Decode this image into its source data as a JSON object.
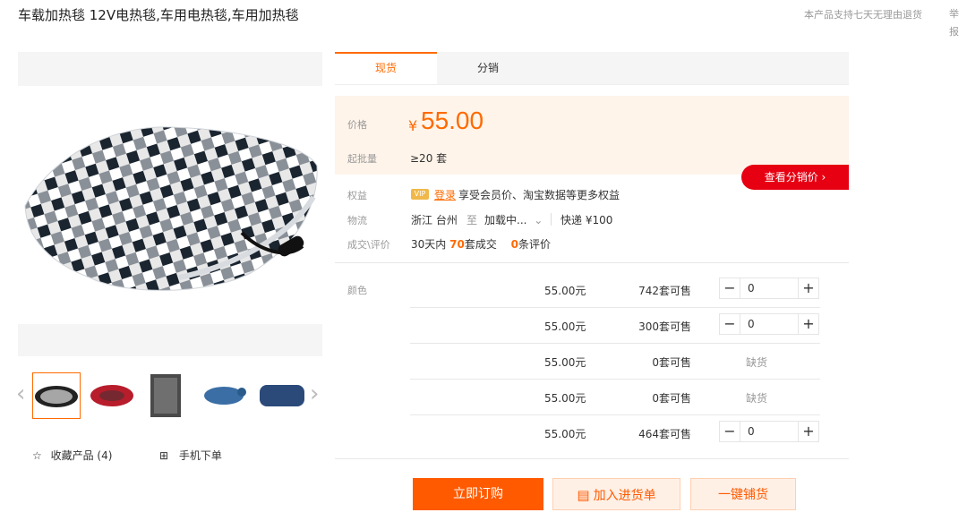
{
  "product": {
    "title": "车载加热毯 12V电热毯,车用电热毯,车用加热毯"
  },
  "header": {
    "return_note": "本产品支持七天无理由退货",
    "report": "举报"
  },
  "gallery": {
    "favorite": "收藏产品 (4)",
    "mobile_order": "手机下单"
  },
  "tabs": [
    "现货",
    "分销"
  ],
  "price": {
    "label": "价格",
    "currency": "¥",
    "value": "55.00",
    "min_label": "起批量",
    "min_value": "≥20 套",
    "distribution_button": "查看分销价 ›"
  },
  "benefits": {
    "label": "权益",
    "badge": "VIP",
    "login": "登录",
    "text": "享受会员价、淘宝数据等更多权益"
  },
  "logistics": {
    "label": "物流",
    "origin": "浙江 台州",
    "to": "至",
    "dest": "加载中...",
    "shipping": "快递 ¥100"
  },
  "deals": {
    "label": "成交\\评价",
    "prefix": "30天内",
    "count": "70",
    "count_suffix": "套成交",
    "reviews": "0",
    "reviews_suffix": "条评价"
  },
  "sku": {
    "color_label": "颜色",
    "rows": [
      {
        "price": "55.00元",
        "stock": "742套可售",
        "qty": "0",
        "available": true
      },
      {
        "price": "55.00元",
        "stock": "300套可售",
        "qty": "0",
        "available": true
      },
      {
        "price": "55.00元",
        "stock": "0套可售",
        "status": "缺货",
        "available": false
      },
      {
        "price": "55.00元",
        "stock": "0套可售",
        "status": "缺货",
        "available": false
      },
      {
        "price": "55.00元",
        "stock": "464套可售",
        "qty": "0",
        "available": true
      }
    ]
  },
  "actions": {
    "order_now": "立即订购",
    "add_to_list": "加入进货单",
    "one_click": "一键铺货"
  },
  "colors": {
    "accent": "#ff6a00",
    "red": "#e60012",
    "price_bg": "#fff4ea"
  }
}
